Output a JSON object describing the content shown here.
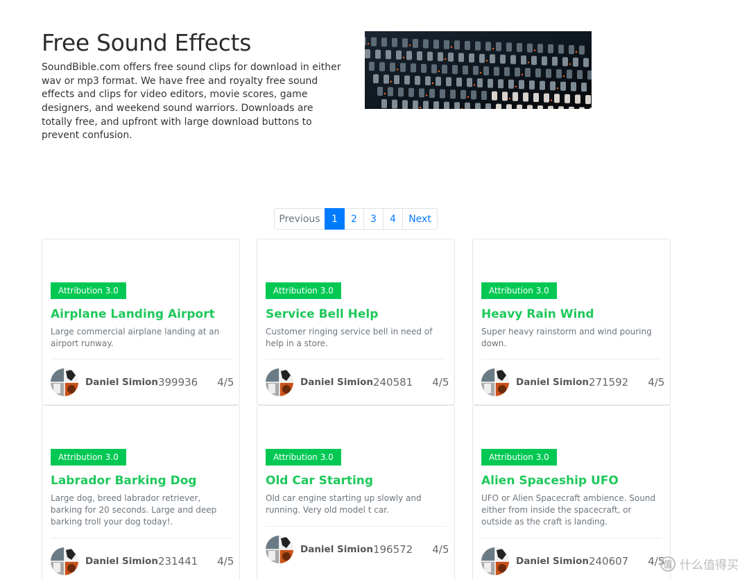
{
  "hero": {
    "title": "Free Sound Effects",
    "description": "SoundBible.com offers free sound clips for download in either wav or mp3 format. We have free and royalty free sound effects and clips for video editors, movie scores, game designers, and weekend sound warriors. Downloads are totally free, and upfront with large download buttons to prevent confusion."
  },
  "pagination": {
    "previous": "Previous",
    "pages": [
      "1",
      "2",
      "3",
      "4"
    ],
    "next": "Next"
  },
  "cards": [
    {
      "badge": "Attribution 3.0",
      "title": "Airplane Landing Airport",
      "description": "Large commercial airplane landing at an airport runway.",
      "author": "Daniel Simion",
      "downloads": "399936",
      "rating": "4/5"
    },
    {
      "badge": "Attribution 3.0",
      "title": "Service Bell Help",
      "description": "Customer ringing service bell in need of help in a store.",
      "author": "Daniel Simion",
      "downloads": "240581",
      "rating": "4/5"
    },
    {
      "badge": "Attribution 3.0",
      "title": "Heavy Rain Wind",
      "description": "Super heavy rainstorm and wind pouring down.",
      "author": "Daniel Simion",
      "downloads": "271592",
      "rating": "4/5"
    },
    {
      "badge": "Attribution 3.0",
      "title": "Labrador Barking Dog",
      "description": "Large dog, breed labrador retriever, barking for 20 seconds. Large and deep barking troll your dog today!.",
      "author": "Daniel Simion",
      "downloads": "231441",
      "rating": "4/5"
    },
    {
      "badge": "Attribution 3.0",
      "title": "Old Car Starting",
      "description": "Old car engine starting up slowly and running. Very old model t car.",
      "author": "Daniel Simion",
      "downloads": "196572",
      "rating": "4/5"
    },
    {
      "badge": "Attribution 3.0",
      "title": "Alien Spaceship UFO",
      "description": "UFO or Alien Spacecraft ambience. Sound either from inside the spacecraft, or outside as the craft is landing.",
      "author": "Daniel Simion",
      "downloads": "240607",
      "rating": "4/5"
    }
  ],
  "watermark": {
    "icon": "值",
    "text": "什么值得买"
  },
  "colors": {
    "accent": "#007bff",
    "badge": "#00c853",
    "title": "#1ec85b"
  }
}
